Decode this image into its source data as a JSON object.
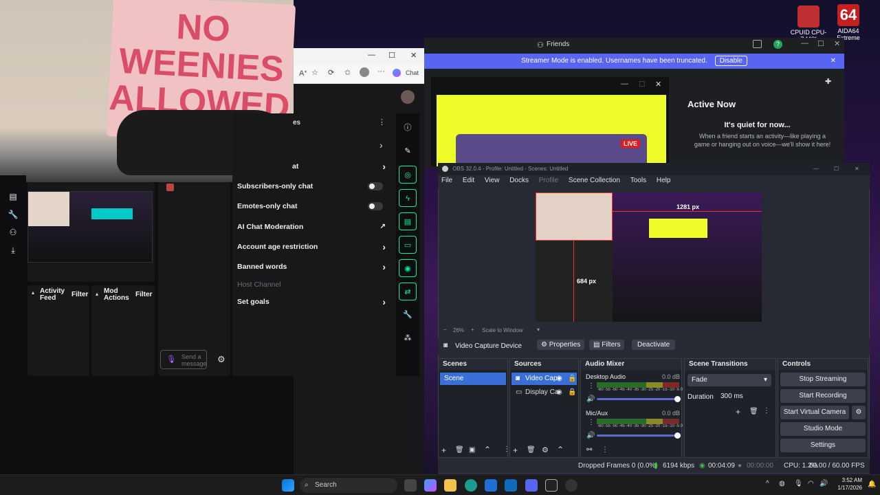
{
  "desktop": {
    "icons": [
      {
        "label": "CPUID CPU-Z MSI",
        "icon": "cpuz-icon"
      },
      {
        "label": "AIDA64 Extreme",
        "icon": "aida64-icon"
      }
    ]
  },
  "webcam": {
    "sign_text": "NO WEENIES ALLOWED"
  },
  "browser": {
    "chat_button": "Chat",
    "controls": {
      "minimize": "—",
      "maximize": "☐",
      "close": "✕"
    }
  },
  "twitch": {
    "settings_header_partial": "es",
    "settings_items": [
      {
        "label": "at",
        "type": "chevron"
      },
      {
        "label": "Subscribers-only chat",
        "type": "toggle"
      },
      {
        "label": "Emotes-only chat",
        "type": "toggle"
      },
      {
        "label": "AI Chat Moderation",
        "type": "external"
      },
      {
        "label": "Account age restriction",
        "type": "chevron"
      },
      {
        "label": "Banned words",
        "type": "chevron"
      },
      {
        "label": "Host Channel",
        "type": "disabled"
      },
      {
        "label": "Set goals",
        "type": "chevron"
      }
    ],
    "activity_feed": {
      "title": "Activity Feed",
      "filter": "Filter"
    },
    "mod_actions": {
      "title": "Mod Actions",
      "filter": "Filter"
    },
    "send_message_placeholder": "Send a message"
  },
  "discord": {
    "title": "Friends",
    "banner_text": "Streamer Mode is enabled. Usernames have been truncated.",
    "banner_button": "Disable",
    "active_now": {
      "title": "Active Now",
      "subtitle": "It's quiet for now...",
      "body": "When a friend starts an activity—like playing a game or hanging out on voice—we'll show it here!"
    },
    "live_badge": "LIVE"
  },
  "obs": {
    "title": "OBS 32.0.4 - Profile: Untitled - Scenes: Untitled",
    "menu": [
      "File",
      "Edit",
      "View",
      "Docks",
      "Profile",
      "Scene Collection",
      "Tools",
      "Help"
    ],
    "preview": {
      "dim_width": "1281 px",
      "dim_height": "684 px"
    },
    "zoom": "26%",
    "scale_mode": "Scale to Window",
    "source_bar": {
      "source_name": "Video Capture Device",
      "properties": "Properties",
      "filters": "Filters",
      "deactivate": "Deactivate"
    },
    "scenes": {
      "title": "Scenes",
      "items": [
        "Scene"
      ]
    },
    "sources": {
      "title": "Sources",
      "items": [
        "Video Cap",
        "Display Ca"
      ]
    },
    "audio_mixer": {
      "title": "Audio Mixer",
      "channels": [
        {
          "name": "Desktop Audio",
          "db": "0.0 dB"
        },
        {
          "name": "Mic/Aux",
          "db": "0.0 dB"
        }
      ],
      "scale": "-60 -55 -50 -45 -40 -35 -30 -25 -20 -15 -10 -5 0"
    },
    "transitions": {
      "title": "Scene Transitions",
      "type": "Fade",
      "duration_label": "Duration",
      "duration": "300 ms"
    },
    "controls": {
      "title": "Controls",
      "buttons": [
        "Stop Streaming",
        "Start Recording",
        "Start Virtual Camera",
        "Studio Mode",
        "Settings"
      ]
    },
    "status": {
      "dropped": "Dropped Frames 0 (0.0%)",
      "bitrate": "6194 kbps",
      "stream_time": "00:04:09",
      "rec_time": "00:00:00",
      "cpu": "CPU: 1.2%",
      "fps": "60.00 / 60.00 FPS"
    }
  },
  "taskbar": {
    "search": "Search",
    "time": "3:52 AM",
    "date": "1/17/2026"
  },
  "colors": {
    "twitch_green": "#00f593",
    "discord_blurple": "#5865f2",
    "obs_selected": "#3b6fd8"
  }
}
